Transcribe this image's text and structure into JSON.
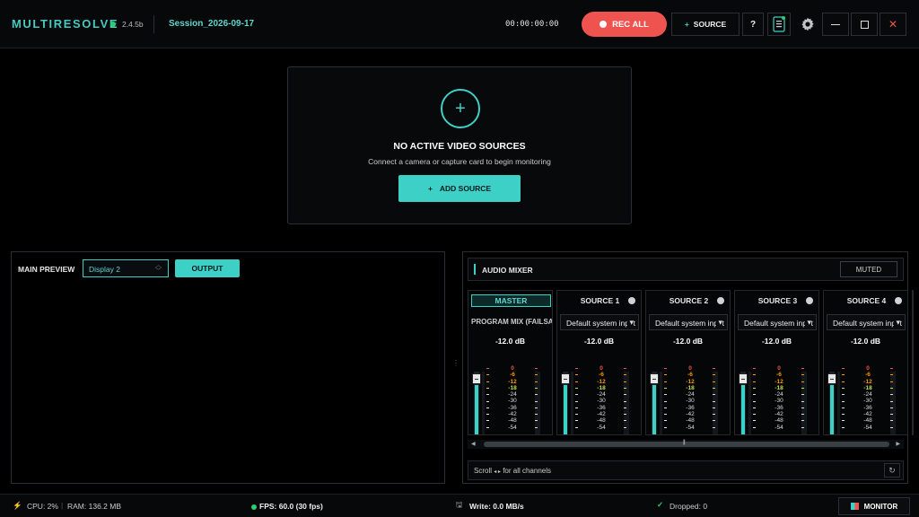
{
  "app": {
    "name": "MULTIRESOLVE",
    "version": "2.4.5b",
    "session": "Session_2026-09-17",
    "timer": "00:00:00:00"
  },
  "toolbar": {
    "rec_label": "REC ALL",
    "source_label": "SOURCE",
    "source_plus": "+",
    "help_label": "?"
  },
  "center": {
    "plus": "+",
    "title": "NO ACTIVE VIDEO SOURCES",
    "subtitle": "Connect a camera or capture card to begin monitoring",
    "add_label": "ADD SOURCE",
    "add_plus": "+"
  },
  "preview": {
    "label": "MAIN PREVIEW",
    "display_value": "Display 2",
    "output_label": "OUTPUT"
  },
  "mixer": {
    "title": "AUDIO MIXER",
    "muted_label": "MUTED",
    "scale": [
      "0",
      "-6",
      "-12",
      "-18",
      "-24",
      "-30",
      "-36",
      "-42",
      "-48",
      "-54"
    ],
    "master": {
      "label": "MASTER",
      "subtitle": "PROGRAM MIX (FAILSAFE)",
      "db": "-12.0 dB",
      "level": 0.8
    },
    "channels": [
      {
        "label": "SOURCE 1",
        "device": "Default system input",
        "db": "-12.0 dB",
        "level": 0.8
      },
      {
        "label": "SOURCE 2",
        "device": "Default system input",
        "db": "-12.0 dB",
        "level": 0.8
      },
      {
        "label": "SOURCE 3",
        "device": "Default system input",
        "db": "-12.0 dB",
        "level": 0.8
      },
      {
        "label": "SOURCE 4",
        "device": "Default system input",
        "db": "-12.0 dB",
        "level": 0.8
      }
    ],
    "scroll_hint_prefix": "Scroll",
    "scroll_hint_arrows": "◂ ▸",
    "scroll_hint_suffix": "for all channels"
  },
  "status": {
    "cpu": "CPU: 2%",
    "ram": "RAM: 136.2 MB",
    "fps": "FPS: 60.0 (30 fps)",
    "write": "Write: 0.0 MB/s",
    "dropped": "Dropped: 0",
    "monitor_label": "MONITOR"
  },
  "colors": {
    "accent": "#3dd0c6",
    "record": "#ef5350",
    "ok": "#2ecc71",
    "warn": "#ff9800"
  }
}
